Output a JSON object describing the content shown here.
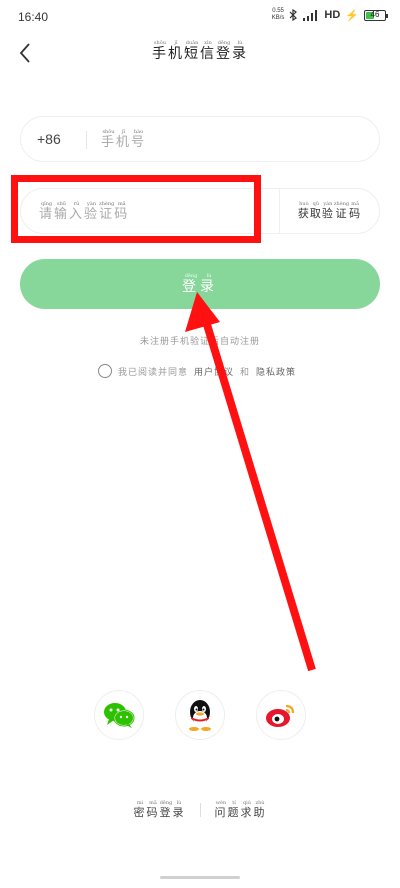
{
  "status_bar": {
    "time": "16:40",
    "net_speed": "0.55",
    "net_unit": "KB/s",
    "network": "HD",
    "battery_level": "46",
    "battery_fraction": 0.46
  },
  "header": {
    "back_icon": "chevron-left-icon",
    "title_chars": [
      {
        "c": "手",
        "p": "shǒu"
      },
      {
        "c": "机",
        "p": "jī"
      },
      {
        "c": "短",
        "p": "duǎn"
      },
      {
        "c": "信",
        "p": "xìn"
      },
      {
        "c": "登",
        "p": "dēng"
      },
      {
        "c": "录",
        "p": "lù"
      }
    ]
  },
  "phone_field": {
    "prefix": "+86",
    "placeholder_chars": [
      {
        "c": "手",
        "p": "shǒu"
      },
      {
        "c": "机",
        "p": "jī"
      },
      {
        "c": "号",
        "p": "hào"
      }
    ]
  },
  "code_field": {
    "placeholder_chars": [
      {
        "c": "请",
        "p": "qǐng"
      },
      {
        "c": "输",
        "p": "shū"
      },
      {
        "c": "入",
        "p": "rù"
      },
      {
        "c": "验",
        "p": "yàn"
      },
      {
        "c": "证",
        "p": "zhèng"
      },
      {
        "c": "码",
        "p": "mǎ"
      }
    ],
    "get_code_chars": [
      {
        "c": "获",
        "p": "huò"
      },
      {
        "c": "取",
        "p": "qǔ"
      },
      {
        "c": "验",
        "p": "yàn"
      },
      {
        "c": "证",
        "p": "zhèng"
      },
      {
        "c": "码",
        "p": "mǎ"
      }
    ]
  },
  "login_button": {
    "chars": [
      {
        "c": "登",
        "p": "dēng"
      },
      {
        "c": "录",
        "p": "lù"
      }
    ]
  },
  "hint_text": "未注册手机验证后自动注册",
  "agreement": {
    "prefix": "我已阅读并同意",
    "user_agreement": "用户协议",
    "connector": "和",
    "privacy_policy": "隐私政策"
  },
  "social_logins": [
    {
      "name": "wechat",
      "icon": "wechat-icon"
    },
    {
      "name": "qq",
      "icon": "qq-icon"
    },
    {
      "name": "weibo",
      "icon": "weibo-icon"
    }
  ],
  "footer": {
    "password_login_chars": [
      {
        "c": "密",
        "p": "mì"
      },
      {
        "c": "码",
        "p": "mǎ"
      },
      {
        "c": "登",
        "p": "dēng"
      },
      {
        "c": "录",
        "p": "lù"
      }
    ],
    "help_chars": [
      {
        "c": "问",
        "p": "wèn"
      },
      {
        "c": "题",
        "p": "tí"
      },
      {
        "c": "求",
        "p": "qiú"
      },
      {
        "c": "助",
        "p": "zhù"
      }
    ]
  },
  "colors": {
    "accent": "#86d799",
    "highlight": "#ff1111",
    "arrow": "#ff1111"
  }
}
